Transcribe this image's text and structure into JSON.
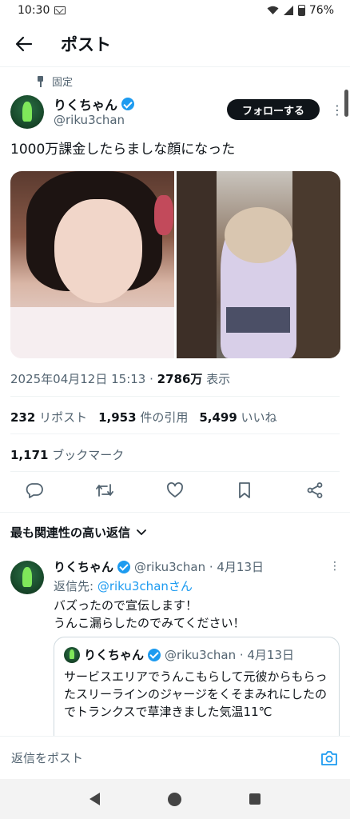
{
  "status_bar": {
    "time": "10:30",
    "battery": "76%"
  },
  "header": {
    "title": "ポスト"
  },
  "tweet": {
    "pinned_label": "固定",
    "display_name": "りくちゃん",
    "handle": "@riku3chan",
    "follow_label": "フォローする",
    "text": "1000万課金したらましな顔になった",
    "timestamp": "2025年04月12日 15:13",
    "views": "2786万",
    "views_label": " 表示",
    "stats": {
      "reposts": "232",
      "reposts_label": " リポスト",
      "quotes": "1,953",
      "quotes_label": " 件の引用",
      "likes": "5,499",
      "likes_label": " いいね",
      "bookmarks": "1,171",
      "bookmarks_label": " ブックマーク"
    }
  },
  "replies_sort": {
    "label": "最も関連性の高い返信"
  },
  "reply": {
    "display_name": "りくちゃん",
    "handle_date": "@riku3chan · 4月13日",
    "reply_to_prefix": "返信先: ",
    "reply_to_handle": "@riku3chanさん",
    "line1": "バズったので宣伝します！",
    "line2": "うんこ漏らしたのでみてください！",
    "quote": {
      "display_name": "りくちゃん",
      "handle_date": "@riku3chan · 4月13日",
      "text": "サービスエリアでうんこもらして元彼からもらったスリーラインのジャージをくそまみれにしたのでトランクスで草津きました気温11℃"
    }
  },
  "compose": {
    "placeholder": "返信をポスト"
  },
  "icons": {
    "back": "arrow-left-icon",
    "reply": "comment-icon",
    "repost": "repost-icon",
    "like": "heart-icon",
    "bookmark": "bookmark-icon",
    "share": "share-icon",
    "camera": "camera-icon",
    "verified": "verified-badge-icon"
  },
  "colors": {
    "accent": "#1d9bf0",
    "text": "#0f1419",
    "secondary": "#536471"
  }
}
